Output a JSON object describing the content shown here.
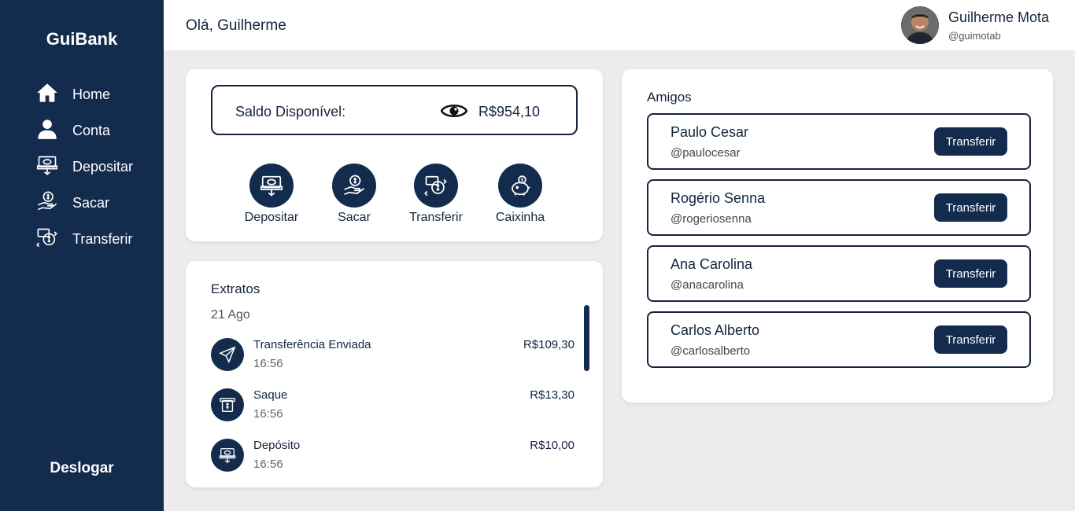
{
  "app": {
    "brand": "GuiBank"
  },
  "sidebar": {
    "items": [
      {
        "label": "Home",
        "icon": "home-icon"
      },
      {
        "label": "Conta",
        "icon": "user-icon"
      },
      {
        "label": "Depositar",
        "icon": "deposit-icon"
      },
      {
        "label": "Sacar",
        "icon": "withdraw-icon"
      },
      {
        "label": "Transferir",
        "icon": "transfer-icon"
      }
    ],
    "logout_label": "Deslogar"
  },
  "header": {
    "greeting": "Olá, Guilherme",
    "user_name": "Guilherme Mota",
    "user_handle": "@guimotab",
    "avatar_icon": "avatar-photo"
  },
  "balance": {
    "label": "Saldo Disponível:",
    "value": "R$954,10",
    "visibility_icon": "eye-icon"
  },
  "actions": [
    {
      "label": "Depositar",
      "icon": "deposit-icon"
    },
    {
      "label": "Sacar",
      "icon": "withdraw-icon"
    },
    {
      "label": "Transferir",
      "icon": "transfer-icon"
    },
    {
      "label": "Caixinha",
      "icon": "piggy-bank-icon"
    }
  ],
  "statement": {
    "title": "Extratos",
    "date": "21 Ago",
    "transactions": [
      {
        "name": "Transferência Enviada",
        "time": "16:56",
        "amount": "R$109,30",
        "icon": "send-icon"
      },
      {
        "name": "Saque",
        "time": "16:56",
        "amount": "R$13,30",
        "icon": "atm-icon"
      },
      {
        "name": "Depósito",
        "time": "16:56",
        "amount": "R$10,00",
        "icon": "deposit-icon"
      }
    ]
  },
  "friends": {
    "title": "Amigos",
    "button_label": "Transferir",
    "list": [
      {
        "name": "Paulo Cesar",
        "handle": "@paulocesar"
      },
      {
        "name": "Rogério Senna",
        "handle": "@rogeriosenna"
      },
      {
        "name": "Ana Carolina",
        "handle": "@anacarolina"
      },
      {
        "name": "Carlos Alberto",
        "handle": "@carlosalberto"
      }
    ]
  },
  "colors": {
    "primary": "#132c4e",
    "background": "#ececec",
    "surface": "#ffffff",
    "text": "#14243e"
  }
}
